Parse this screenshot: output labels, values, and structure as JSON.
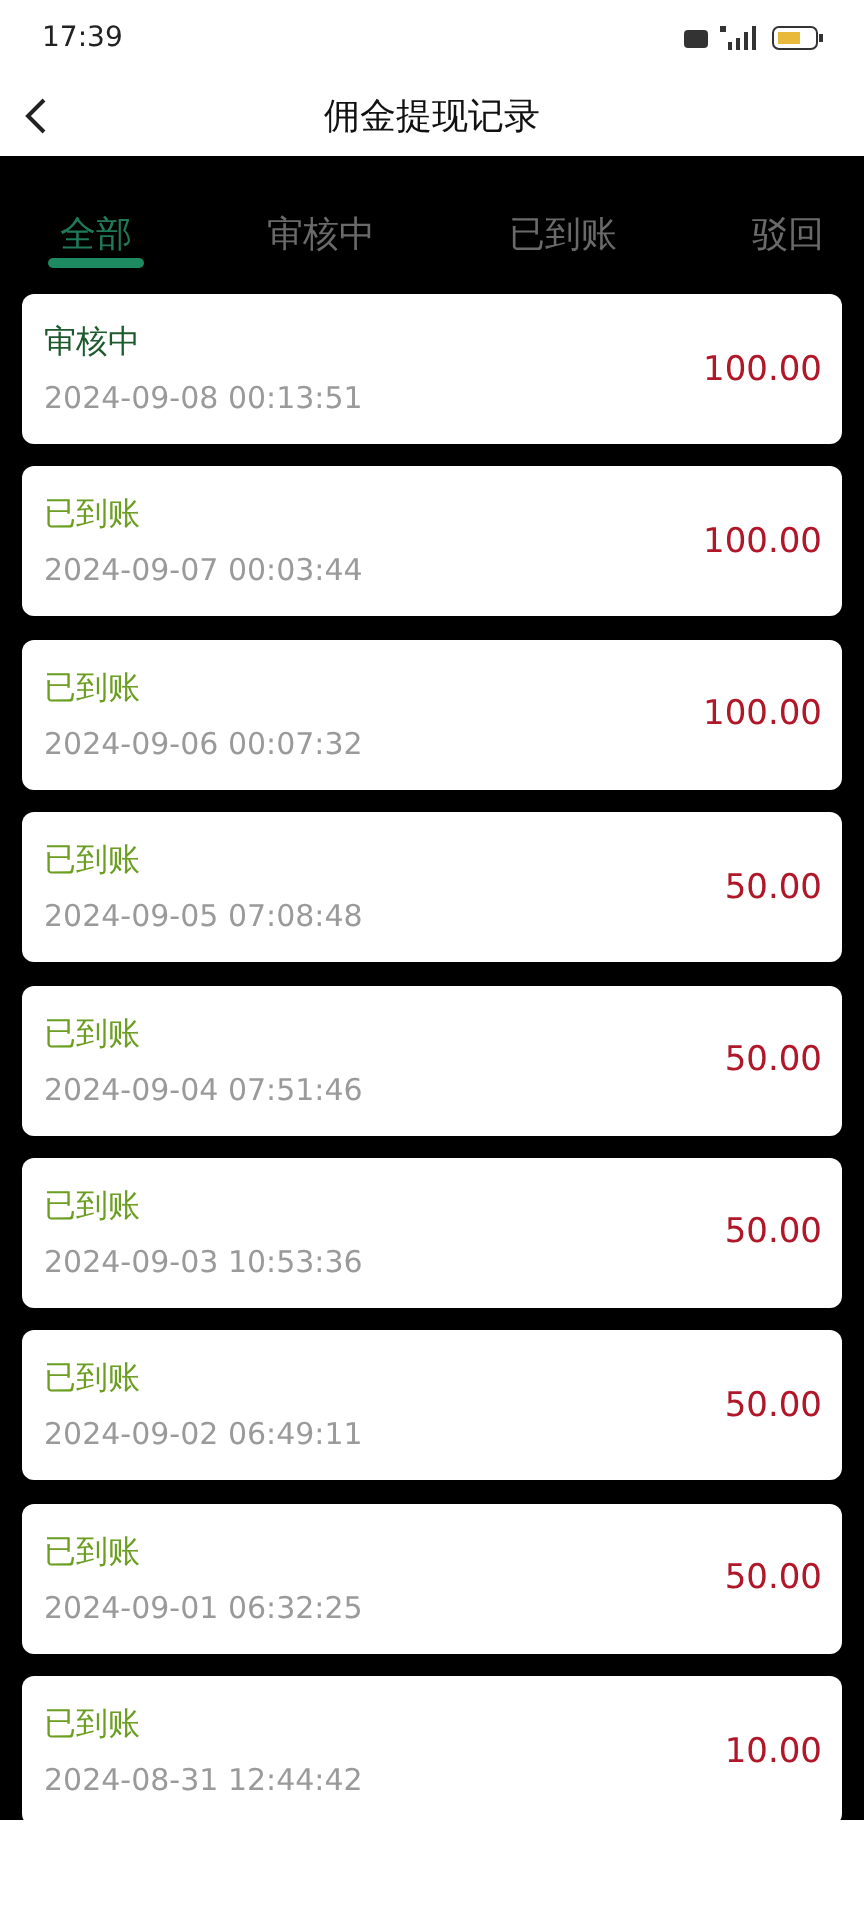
{
  "status_bar": {
    "time": "17:39"
  },
  "header": {
    "title": "佣金提现记录"
  },
  "tabs": [
    {
      "label": "全部",
      "selected": true
    },
    {
      "label": "审核中",
      "selected": false
    },
    {
      "label": "已到账",
      "selected": false
    },
    {
      "label": "驳回",
      "selected": false
    }
  ],
  "records": [
    {
      "status": "审核中",
      "kind": "pending",
      "time": "2024-09-08 00:13:51",
      "amount": "100.00"
    },
    {
      "status": "已到账",
      "kind": "paid",
      "time": "2024-09-07 00:03:44",
      "amount": "100.00"
    },
    {
      "status": "已到账",
      "kind": "paid",
      "time": "2024-09-06 00:07:32",
      "amount": "100.00"
    },
    {
      "status": "已到账",
      "kind": "paid",
      "time": "2024-09-05 07:08:48",
      "amount": "50.00"
    },
    {
      "status": "已到账",
      "kind": "paid",
      "time": "2024-09-04 07:51:46",
      "amount": "50.00"
    },
    {
      "status": "已到账",
      "kind": "paid",
      "time": "2024-09-03 10:53:36",
      "amount": "50.00"
    },
    {
      "status": "已到账",
      "kind": "paid",
      "time": "2024-09-02 06:49:11",
      "amount": "50.00"
    },
    {
      "status": "已到账",
      "kind": "paid",
      "time": "2024-09-01 06:32:25",
      "amount": "50.00"
    },
    {
      "status": "已到账",
      "kind": "paid",
      "time": "2024-08-31 12:44:42",
      "amount": "10.00"
    }
  ]
}
